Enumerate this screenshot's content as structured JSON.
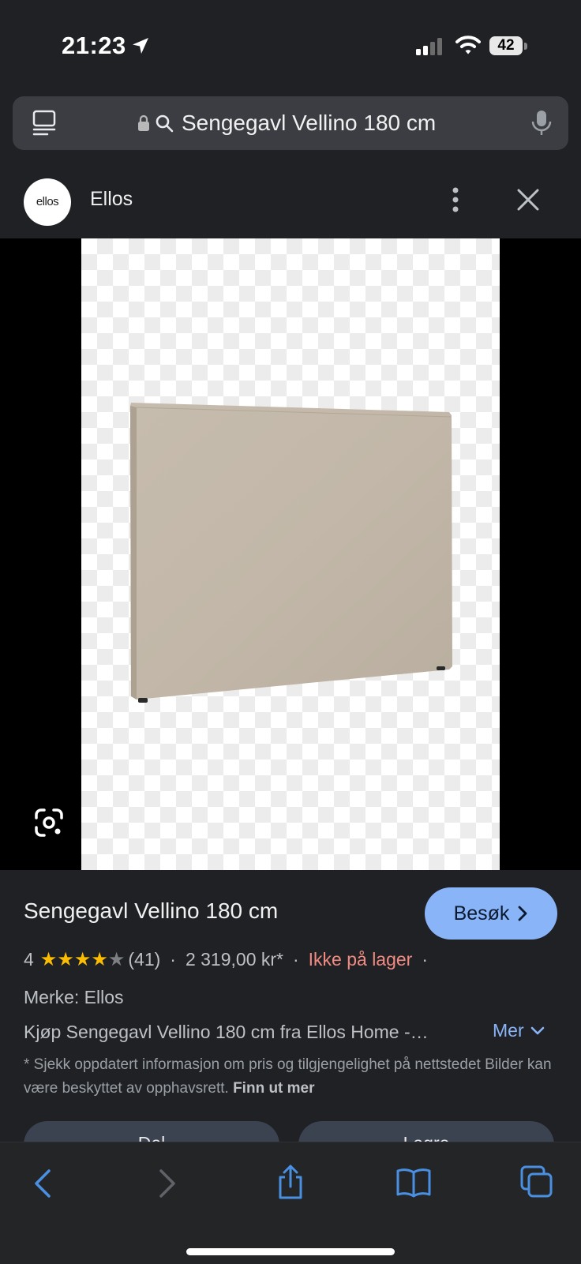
{
  "status_bar": {
    "time": "21:23",
    "battery": "42"
  },
  "url_bar": {
    "query": "Sengegavl Vellino 180 cm"
  },
  "source": {
    "logo_text": "ellos",
    "site_name": "Ellos"
  },
  "product": {
    "title": "Sengegavl Vellino 180 cm",
    "visit_label": "Besøk",
    "rating": "4",
    "stars_filled": 4,
    "stars_total": 5,
    "review_count": "(41)",
    "separator": "·",
    "price": "2 319,00 kr*",
    "stock": "Ikke på lager",
    "brand": "Merke: Ellos",
    "description": "Kjøp Sengegavl Vellino 180 cm fra Ellos Home -…",
    "more_label": "Mer",
    "disclaimer": "* Sjekk oppdatert informasjon om pris og tilgjengelighet på nettstedet Bilder kan være beskyttet av opphavsrett.",
    "disclaimer_link": "Finn ut mer",
    "share_label": "Del",
    "save_label": "Lagre"
  },
  "colors": {
    "background": "#202124",
    "accent": "#8ab4f8",
    "out_of_stock": "#f28b82",
    "star": "#fbbc04",
    "headboard": "#c3b8a9"
  },
  "icons": [
    "location-arrow-icon",
    "signal-icon",
    "wifi-icon",
    "battery-icon",
    "tabs-icon",
    "lock-icon",
    "search-icon",
    "mic-icon",
    "more-vert-icon",
    "close-icon",
    "lens-icon",
    "chevron-right-icon",
    "chevron-down-icon",
    "back-icon",
    "forward-icon",
    "share-icon",
    "bookmarks-icon",
    "tab-switcher-icon"
  ]
}
